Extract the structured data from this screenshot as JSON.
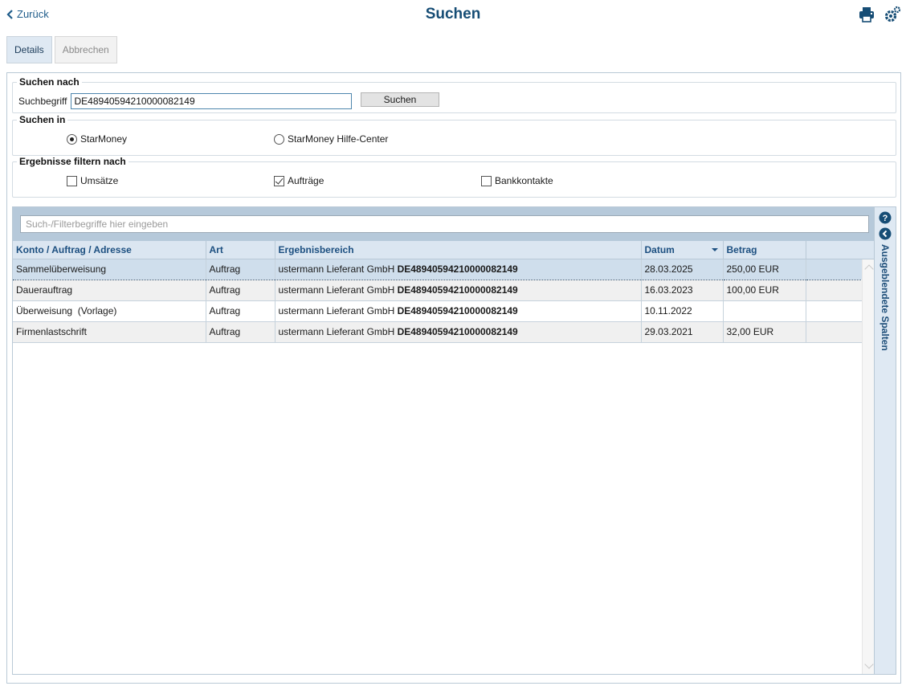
{
  "header": {
    "back_label": "Zurück",
    "title": "Suchen",
    "icons": [
      "print-icon",
      "gear-icon"
    ]
  },
  "tabs": [
    {
      "label": "Details",
      "state": "active"
    },
    {
      "label": "Abbrechen",
      "state": "disabled"
    }
  ],
  "search_by": {
    "legend": "Suchen nach",
    "label": "Suchbegriff",
    "value": "DE48940594210000082149",
    "button": "Suchen"
  },
  "search_in": {
    "legend": "Suchen in",
    "options": [
      {
        "label": "StarMoney",
        "selected": true
      },
      {
        "label": "StarMoney Hilfe-Center",
        "selected": false
      }
    ]
  },
  "filter": {
    "legend": "Ergebnisse filtern nach",
    "options": [
      {
        "label": "Umsätze",
        "checked": false
      },
      {
        "label": "Aufträge",
        "checked": true
      },
      {
        "label": "Bankkontakte",
        "checked": false
      }
    ]
  },
  "results": {
    "filter_placeholder": "Such-/Filterbegriffe hier eingeben",
    "side_rail_label": "Ausgeblendete Spalten",
    "columns": [
      "Konto / Auftrag / Adresse",
      "Art",
      "Ergebnisbereich",
      "Datum",
      "Betrag"
    ],
    "sort_column": "Datum",
    "rows": [
      {
        "konto": "Sammelüberweisung",
        "art": "Auftrag",
        "bereich_text": "ustermann Lieferant GmbH",
        "bereich_ref": "DE48940594210000082149",
        "datum": "28.03.2025",
        "betrag": "250,00 EUR"
      },
      {
        "konto": "Dauerauftrag",
        "art": "Auftrag",
        "bereich_text": "ustermann Lieferant GmbH",
        "bereich_ref": "DE48940594210000082149",
        "datum": "16.03.2023",
        "betrag": "100,00 EUR"
      },
      {
        "konto": "Überweisung  (Vorlage)",
        "art": "Auftrag",
        "bereich_text": "ustermann Lieferant GmbH",
        "bereich_ref": "DE48940594210000082149",
        "datum": "10.11.2022",
        "betrag": ""
      },
      {
        "konto": "Firmenlastschrift",
        "art": "Auftrag",
        "bereich_text": "ustermann Lieferant GmbH",
        "bereich_ref": "DE48940594210000082149",
        "datum": "29.03.2021",
        "betrag": "32,00 EUR"
      }
    ]
  },
  "colors": {
    "title": "#164d75",
    "header_bg": "#dbe6f1",
    "selected_row": "#cfdeec",
    "topbar": "#b6c9da"
  }
}
